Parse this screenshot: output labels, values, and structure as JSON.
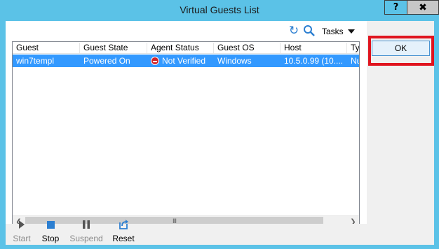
{
  "window": {
    "title": "Virtual Guests List",
    "help_label": "?",
    "close_label": "✖"
  },
  "toolbar": {
    "tasks_label": "Tasks"
  },
  "table": {
    "columns": [
      "Guest",
      "Guest State",
      "Agent Status",
      "Guest OS",
      "Host",
      "Typ"
    ],
    "rows": [
      {
        "guest": "win7templ",
        "state": "Powered On",
        "agent": "Not Verified",
        "os": "Windows",
        "host": "10.5.0.99 (10....",
        "type": "Nu"
      }
    ],
    "scroll_thumb": "III"
  },
  "ok_label": "OK",
  "actions": {
    "start": "Start",
    "stop": "Stop",
    "suspend": "Suspend",
    "reset": "Reset"
  },
  "colors": {
    "titlebar": "#5bc2e7",
    "selection": "#3399ff",
    "highlight_frame": "#e0141e",
    "accent": "#2c7fd1"
  }
}
